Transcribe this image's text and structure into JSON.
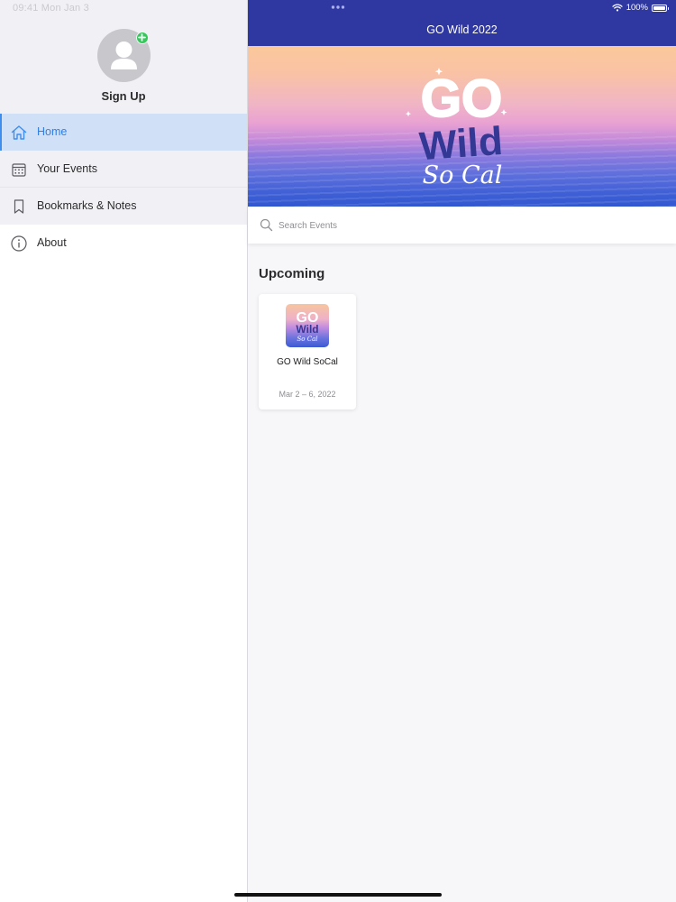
{
  "status_bar": {
    "left_text": "09:41  Mon Jan 3",
    "battery": "100%"
  },
  "sidebar": {
    "signup_label": "Sign Up",
    "items": [
      {
        "label": "Home",
        "icon": "home-icon",
        "active": true
      },
      {
        "label": "Your Events",
        "icon": "calendar-icon",
        "active": false
      },
      {
        "label": "Bookmarks & Notes",
        "icon": "bookmark-icon",
        "active": false
      },
      {
        "label": "About",
        "icon": "info-icon",
        "active": false
      }
    ]
  },
  "header": {
    "title": "GO Wild 2022"
  },
  "banner": {
    "logo_text": "GO Wild So Cal"
  },
  "search": {
    "placeholder": "Search Events",
    "value": ""
  },
  "upcoming": {
    "title": "Upcoming",
    "events": [
      {
        "name": "GO Wild SoCal",
        "dates": "Mar 2 – 6, 2022"
      }
    ]
  },
  "colors": {
    "accent": "#2f7fe6",
    "navbar": "#2f37a1",
    "active_bg": "#cfe0f7",
    "badge": "#34c759"
  }
}
